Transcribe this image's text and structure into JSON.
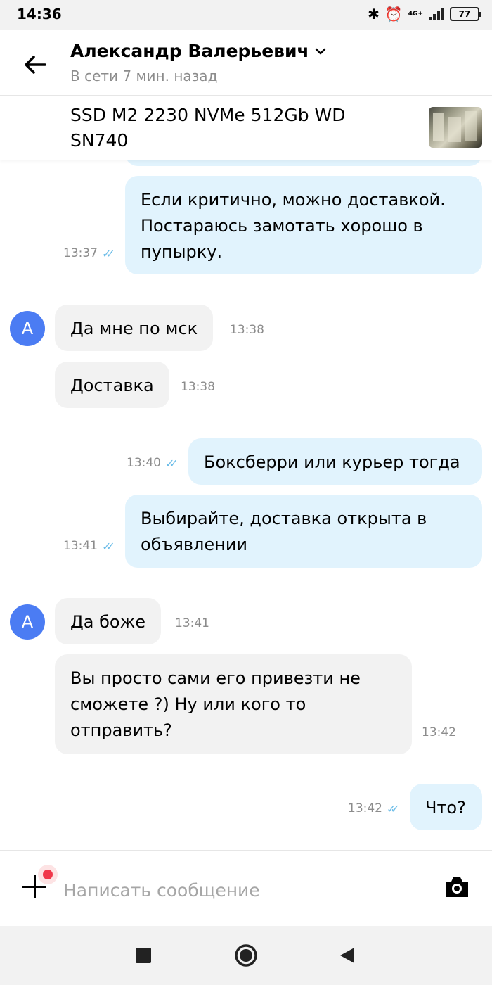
{
  "status_bar": {
    "time": "14:36",
    "network": "4G+",
    "battery": "77"
  },
  "header": {
    "contact_name": "Александр Валерьевич",
    "contact_status": "В сети 7 мин. назад"
  },
  "item": {
    "title": "SSD M2 2230 NVMe 512Gb WD SN740"
  },
  "messages": [
    {
      "direction": "out",
      "text": "Если критично, можно доставкой. Постараюсь замотать хорошо в пупырку.",
      "time": "13:37",
      "read": true
    },
    {
      "direction": "in",
      "avatar": "А",
      "text": "Да мне по мск",
      "time": "13:38"
    },
    {
      "direction": "in",
      "text": "Доставка",
      "time": "13:38"
    },
    {
      "direction": "out",
      "text": "Боксберри или курьер тогда",
      "time": "13:40",
      "read": true
    },
    {
      "direction": "out",
      "text": "Выбирайте, доставка открыта в объявлении",
      "time": "13:41",
      "read": true
    },
    {
      "direction": "in",
      "avatar": "А",
      "text": "Да боже",
      "time": "13:41"
    },
    {
      "direction": "in",
      "text": "Вы просто сами его привезти не сможете ?) Ну или кого то отправить?",
      "time": "13:42"
    },
    {
      "direction": "out",
      "text": "Что?",
      "time": "13:42",
      "read": true
    }
  ],
  "composer": {
    "placeholder": "Написать сообщение"
  },
  "colors": {
    "outgoing_bubble": "#e1f3fd",
    "incoming_bubble": "#f2f2f2",
    "avatar": "#4b7cf3",
    "read_ticks": "#6dbde8",
    "notification_dot": "#f0384b"
  },
  "icons": [
    "back-arrow-icon",
    "chevron-down-icon",
    "plus-icon",
    "camera-icon",
    "nav-square-icon",
    "nav-circle-icon",
    "nav-triangle-icon"
  ]
}
